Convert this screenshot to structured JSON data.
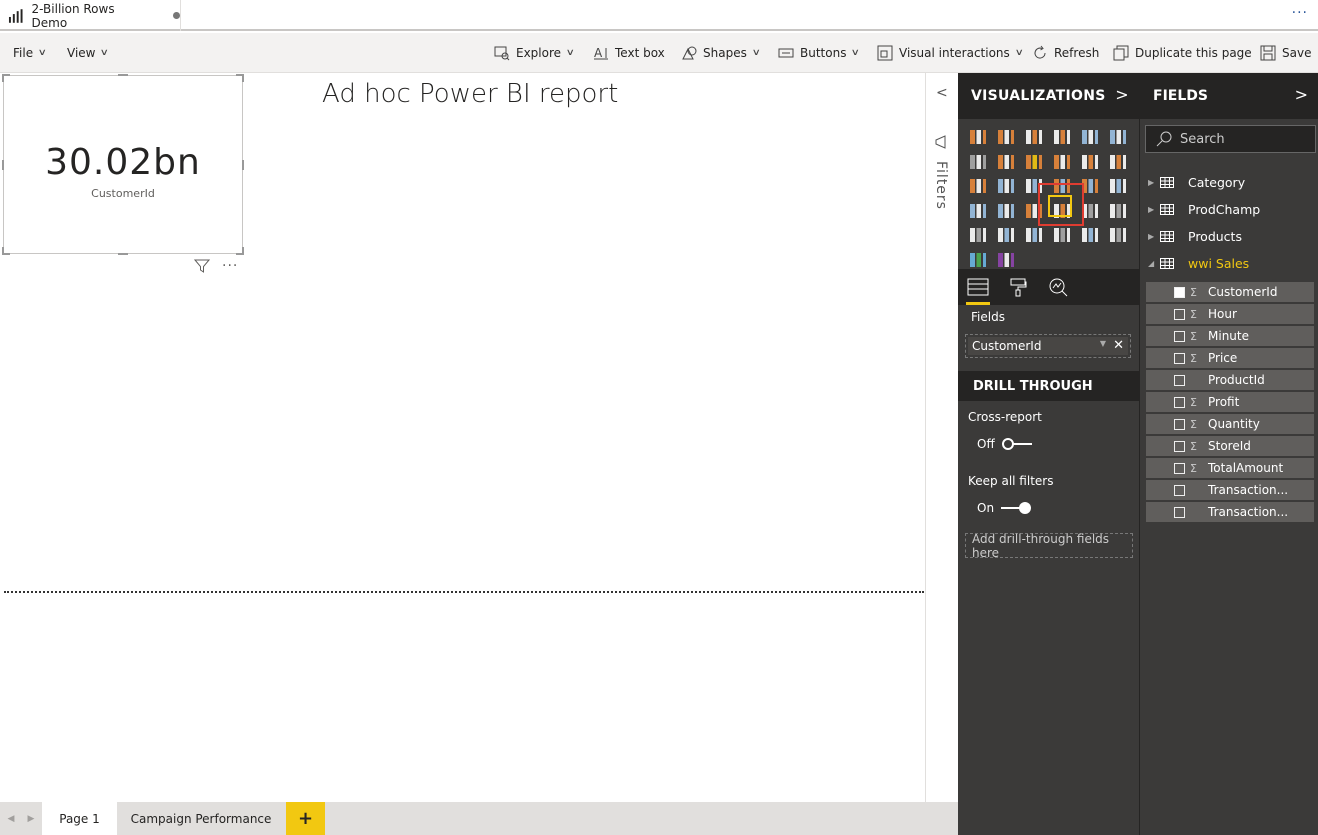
{
  "window": {
    "title": "2-Billion Rows Demo"
  },
  "menu": {
    "file": "File",
    "view": "View"
  },
  "toolbar": {
    "explore": "Explore",
    "textbox": "Text box",
    "shapes": "Shapes",
    "buttons": "Buttons",
    "visual_interactions": "Visual interactions",
    "refresh": "Refresh",
    "duplicate": "Duplicate this page",
    "save": "Save"
  },
  "report": {
    "title": "Ad hoc Power BI report",
    "card": {
      "value": "30.02bn",
      "label": "CustomerId"
    }
  },
  "filters_pane": {
    "label": "Filters"
  },
  "visualizations": {
    "header": "VISUALIZATIONS",
    "fields_label": "Fields",
    "field_well_value": "CustomerId",
    "drill_through_header": "DRILL THROUGH",
    "cross_report_label": "Cross-report",
    "cross_report_state": "Off",
    "keep_filters_label": "Keep all filters",
    "keep_filters_state": "On",
    "drill_placeholder": "Add drill-through fields here",
    "accent_color": "#f2c811",
    "selected_outline_color": "#e03c31"
  },
  "fields_pane": {
    "header": "FIELDS",
    "search_placeholder": "Search",
    "tables": [
      {
        "name": "Category",
        "expanded": false
      },
      {
        "name": "ProdChamp",
        "expanded": false
      },
      {
        "name": "Products",
        "expanded": false
      },
      {
        "name": "wwi Sales",
        "expanded": true
      }
    ],
    "fields": [
      {
        "name": "CustomerId",
        "sigma": "Σ",
        "checked": true
      },
      {
        "name": "Hour",
        "sigma": "Σ",
        "checked": false
      },
      {
        "name": "Minute",
        "sigma": "Σ",
        "checked": false
      },
      {
        "name": "Price",
        "sigma": "Σ",
        "checked": false
      },
      {
        "name": "ProductId",
        "sigma": "",
        "checked": false
      },
      {
        "name": "Profit",
        "sigma": "Σ",
        "checked": false
      },
      {
        "name": "Quantity",
        "sigma": "Σ",
        "checked": false
      },
      {
        "name": "StoreId",
        "sigma": "Σ",
        "checked": false
      },
      {
        "name": "TotalAmount",
        "sigma": "Σ",
        "checked": false
      },
      {
        "name": "Transaction...",
        "sigma": "",
        "checked": false
      },
      {
        "name": "Transaction...",
        "sigma": "",
        "checked": false
      }
    ]
  },
  "pages": {
    "tabs": [
      "Page 1",
      "Campaign Performance"
    ],
    "add": "+"
  }
}
